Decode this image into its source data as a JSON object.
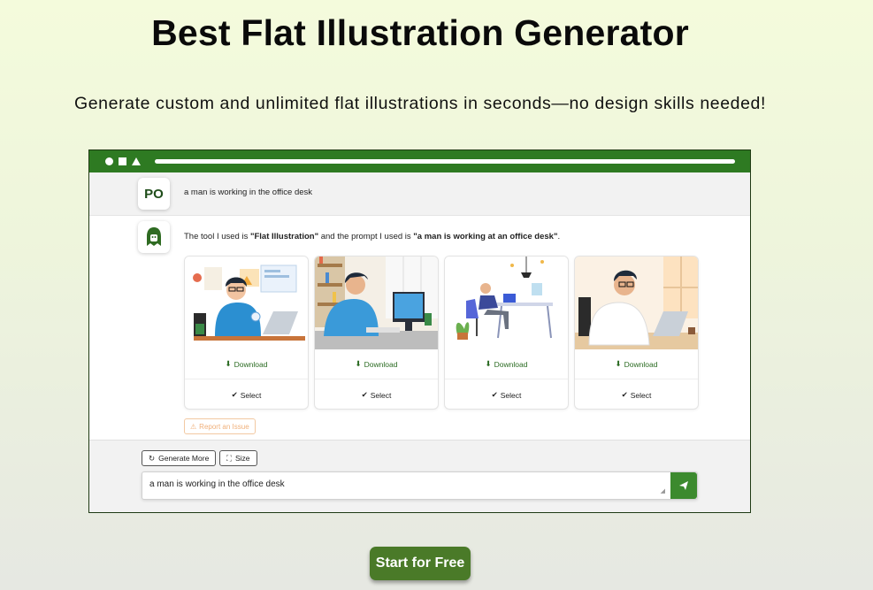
{
  "hero": {
    "title": "Best Flat Illustration Generator",
    "subtitle": "Generate custom and unlimited flat illustrations in seconds—no design skills needed!"
  },
  "chat": {
    "user_avatar": "PO",
    "user_message": "a man is working in the office desk",
    "bot_intro": "The tool I used is ",
    "bot_tool": "\"Flat Illustration\"",
    "bot_mid": " and the prompt I used is ",
    "bot_prompt": "\"a man is working at an office desk\"",
    "bot_end": "."
  },
  "cards": [
    {
      "download": "Download",
      "select": "Select"
    },
    {
      "download": "Download",
      "select": "Select"
    },
    {
      "download": "Download",
      "select": "Select"
    },
    {
      "download": "Download",
      "select": "Select"
    }
  ],
  "report_label": "Report an Issue",
  "toolbar": {
    "generate_more": "Generate More",
    "size": "Size"
  },
  "prompt_input": {
    "value": "a man is working in the office desk"
  },
  "cta": "Start for Free",
  "colors": {
    "brand_green": "#2e7a22",
    "cta_green": "#4a7a28"
  }
}
